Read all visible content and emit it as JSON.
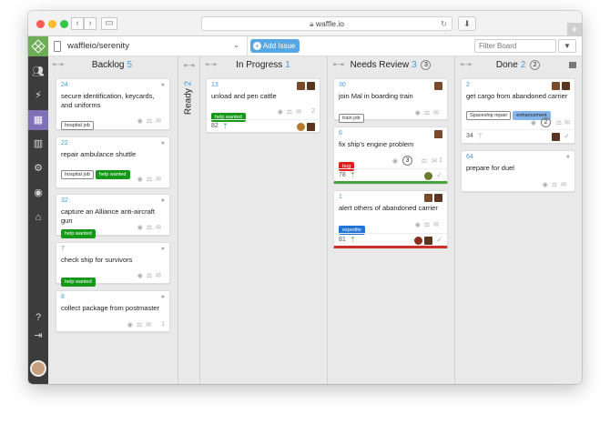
{
  "browser": {
    "url": "waffle.io"
  },
  "topbar": {
    "repo": "waffleio/serenity",
    "add_issue": "Add Issue",
    "filter_placeholder": "Filter Board"
  },
  "columns": [
    {
      "name": "Backlog",
      "count": "5"
    },
    {
      "name": "Ready",
      "count": "2"
    },
    {
      "name": "In Progress",
      "count": "1"
    },
    {
      "name": "Needs Review",
      "count": "3",
      "count2": "3"
    },
    {
      "name": "Done",
      "count": "2",
      "count2": "2"
    }
  ],
  "cards": {
    "b1": {
      "number": "24",
      "title": "secure identification, keycards, and uniforms",
      "labels": [
        "hospital job"
      ]
    },
    "b2": {
      "number": "22",
      "title": "repair ambulance shuttle",
      "labels": [
        "hospital job",
        "help wanted"
      ]
    },
    "b3": {
      "number": "32",
      "title": "capture an Alliance anti-aircraft gun",
      "labels": [
        "help wanted"
      ]
    },
    "b4": {
      "number": "7",
      "title": "check ship for survivors",
      "labels": [
        "help wanted"
      ]
    },
    "b5": {
      "number": "8",
      "title": "collect package from postmaster",
      "comments": "1"
    },
    "p1": {
      "number": "13",
      "title": "unload and pen cattle",
      "labels": [
        "help wanted"
      ],
      "comments": "2",
      "progress": "82"
    },
    "r1": {
      "number": "30",
      "title": "join Mal in boarding train",
      "labels": [
        "train job"
      ]
    },
    "r2": {
      "number": "6",
      "title": "fix ship's engine problem",
      "labels": [
        "bug"
      ],
      "badge": "3",
      "comments": "1",
      "progress": "78"
    },
    "r3": {
      "number": "1",
      "title": "alert others of abandoned carrier",
      "labels": [
        "expedite"
      ],
      "progress": "81"
    },
    "d1": {
      "number": "2",
      "title": "get cargo from abandoned carrier",
      "labels": [
        "Spaceship repair",
        "enhancement"
      ],
      "badge": "2",
      "progress": "34"
    },
    "d2": {
      "number": "64",
      "title": "prepare for duel"
    }
  },
  "colors": {
    "accent": "#4a9bd5",
    "help": "#159818",
    "bug": "#e21b1b",
    "expedite": "#2174d6",
    "enhancement": "#84b6eb",
    "sidebar": "#3c3c3c",
    "active": "#8070b6"
  }
}
